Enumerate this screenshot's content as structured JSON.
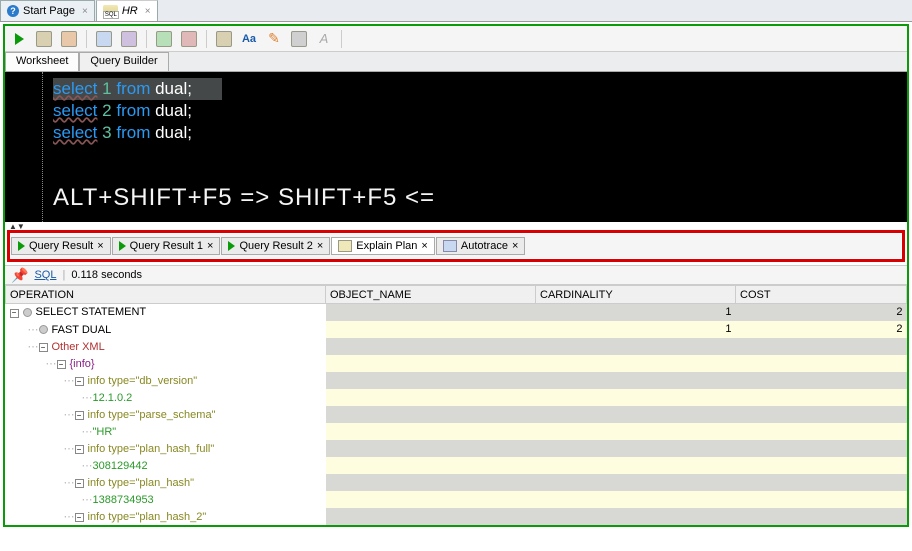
{
  "top_tabs": {
    "start_page": "Start Page",
    "hr": "HR"
  },
  "sub_tabs": {
    "worksheet": "Worksheet",
    "query_builder": "Query Builder"
  },
  "editor": {
    "line1_kw": "select",
    "line1_num": "1",
    "line1_rest": " from dual;",
    "line2_kw": "select",
    "line2_num": "2",
    "line2_rest": " from dual;",
    "line3_kw": "select",
    "line3_num": "3",
    "line3_rest": " from dual;",
    "from_kw": "from",
    "big": "ALT+SHIFT+F5 =>     SHIFT+F5 <="
  },
  "result_tabs": {
    "qr0": "Query Result",
    "qr1": "Query Result 1",
    "qr2": "Query Result 2",
    "explain": "Explain Plan",
    "auto": "Autotrace"
  },
  "status": {
    "sql": "SQL",
    "time": "0.118 seconds"
  },
  "plan_columns": {
    "op": "OPERATION",
    "obj": "OBJECT_NAME",
    "card": "CARDINALITY",
    "cost": "COST"
  },
  "plan_rows": [
    {
      "indent": 0,
      "toggle": "-",
      "dot": true,
      "text": "SELECT STATEMENT",
      "cls": "",
      "obj": "",
      "card": "1",
      "cost": "2"
    },
    {
      "indent": 1,
      "toggle": "",
      "dot": true,
      "text": "FAST DUAL",
      "cls": "",
      "obj": "",
      "card": "1",
      "cost": "2"
    },
    {
      "indent": 1,
      "toggle": "-",
      "dot": false,
      "text": "Other XML",
      "cls": "node-red",
      "obj": "",
      "card": "",
      "cost": ""
    },
    {
      "indent": 2,
      "toggle": "-",
      "dot": false,
      "text": "{info}",
      "cls": "node-purple",
      "obj": "",
      "card": "",
      "cost": ""
    },
    {
      "indent": 3,
      "toggle": "-",
      "dot": false,
      "text": "info type=\"db_version\"",
      "cls": "node-olive",
      "obj": "",
      "card": "",
      "cost": ""
    },
    {
      "indent": 4,
      "toggle": "",
      "dot": false,
      "text": "12.1.0.2",
      "cls": "node-green",
      "obj": "",
      "card": "",
      "cost": ""
    },
    {
      "indent": 3,
      "toggle": "-",
      "dot": false,
      "text": "info type=\"parse_schema\"",
      "cls": "node-olive",
      "obj": "",
      "card": "",
      "cost": ""
    },
    {
      "indent": 4,
      "toggle": "",
      "dot": false,
      "text": "\"HR\"",
      "cls": "node-green",
      "obj": "",
      "card": "",
      "cost": ""
    },
    {
      "indent": 3,
      "toggle": "-",
      "dot": false,
      "text": "info type=\"plan_hash_full\"",
      "cls": "node-olive",
      "obj": "",
      "card": "",
      "cost": ""
    },
    {
      "indent": 4,
      "toggle": "",
      "dot": false,
      "text": "308129442",
      "cls": "node-green",
      "obj": "",
      "card": "",
      "cost": ""
    },
    {
      "indent": 3,
      "toggle": "-",
      "dot": false,
      "text": "info type=\"plan_hash\"",
      "cls": "node-olive",
      "obj": "",
      "card": "",
      "cost": ""
    },
    {
      "indent": 4,
      "toggle": "",
      "dot": false,
      "text": "1388734953",
      "cls": "node-green",
      "obj": "",
      "card": "",
      "cost": ""
    },
    {
      "indent": 3,
      "toggle": "-",
      "dot": false,
      "text": "info type=\"plan_hash_2\"",
      "cls": "node-olive",
      "obj": "",
      "card": "",
      "cost": ""
    }
  ]
}
